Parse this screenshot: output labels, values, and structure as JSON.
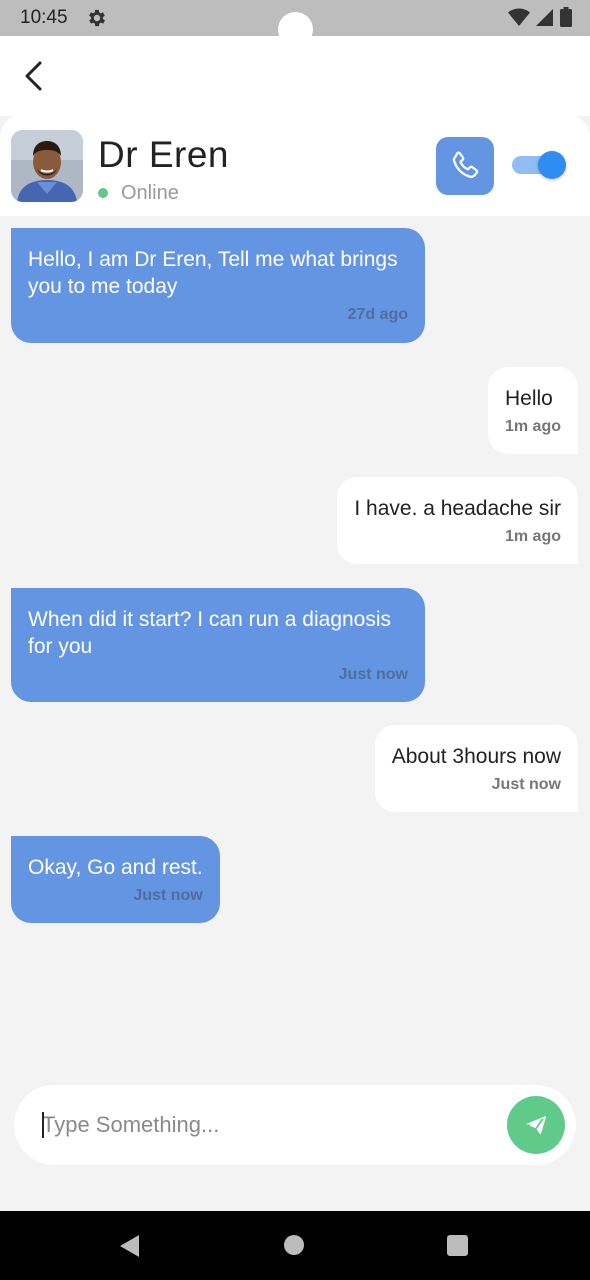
{
  "status_bar": {
    "time": "10:45"
  },
  "doctor": {
    "name": "Dr Eren",
    "status": "Online"
  },
  "messages": [
    {
      "direction": "in",
      "text": "Hello, I am Dr Eren, Tell me what brings you to me today",
      "time": "27d ago"
    },
    {
      "direction": "out",
      "text": "Hello",
      "time": "1m ago"
    },
    {
      "direction": "out",
      "text": "I have. a headache sir",
      "time": "1m ago"
    },
    {
      "direction": "in",
      "text": "When did it start? I can run a diagnosis for you",
      "time": "Just now"
    },
    {
      "direction": "out",
      "text": "About 3hours now",
      "time": "Just now"
    },
    {
      "direction": "in",
      "text": "Okay, Go and rest.",
      "time": "Just now"
    }
  ],
  "composer": {
    "placeholder": "Type Something...",
    "value": ""
  },
  "colors": {
    "incoming_bubble": "#6495e3",
    "outgoing_bubble": "#ffffff",
    "online": "#5fca8a",
    "call_button": "#6495e3",
    "send_button": "#5fca8a",
    "toggle_on": "#2f8cf0"
  },
  "icons": [
    "gear-icon",
    "wifi-icon",
    "signal-icon",
    "battery-icon",
    "back-arrow-icon",
    "phone-icon",
    "send-icon",
    "nav-back-icon",
    "nav-home-icon",
    "nav-recent-icon"
  ],
  "toggle": {
    "on": true
  }
}
